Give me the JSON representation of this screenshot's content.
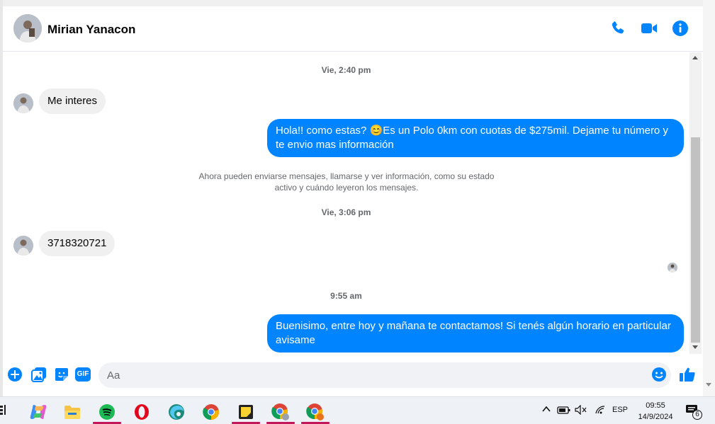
{
  "header": {
    "contact_name": "Mirian Yanacon",
    "icons": [
      "phone-icon",
      "video-icon",
      "info-icon"
    ],
    "accent_color": "#0084ff"
  },
  "messages": {
    "ts1": "Vie, 2:40 pm",
    "in1": "Me interes",
    "out1": "Hola!! como estas? 😊Es un Polo 0km con cuotas de $275mil. Dejame tu número y te envio mas información",
    "system_line1": "Ahora pueden enviarse mensajes, llamarse y ver información, como su estado",
    "system_line2": "activo y cuándo leyeron los mensajes.",
    "ts2": "Vie, 3:06 pm",
    "in2": "3718320721",
    "ts3": "9:55 am",
    "out2": "Buenisimo, entre hoy y mañana te contactamos! Si tenés algún horario en particular avisame"
  },
  "composer": {
    "placeholder": "Aa",
    "gif_label": "GIF",
    "icons": [
      "plus-icon",
      "image-icon",
      "sticker-icon",
      "gif-icon",
      "emoji-icon",
      "like-icon"
    ]
  },
  "taskbar": {
    "apps": [
      "copilot",
      "file-explorer",
      "spotify",
      "opera",
      "edge-dev",
      "chrome",
      "sticky-notes",
      "chrome-profile-1",
      "chrome-profile-2"
    ],
    "lang": "ESP",
    "time": "09:55",
    "date": "14/9/2024",
    "notif_count": "6"
  }
}
